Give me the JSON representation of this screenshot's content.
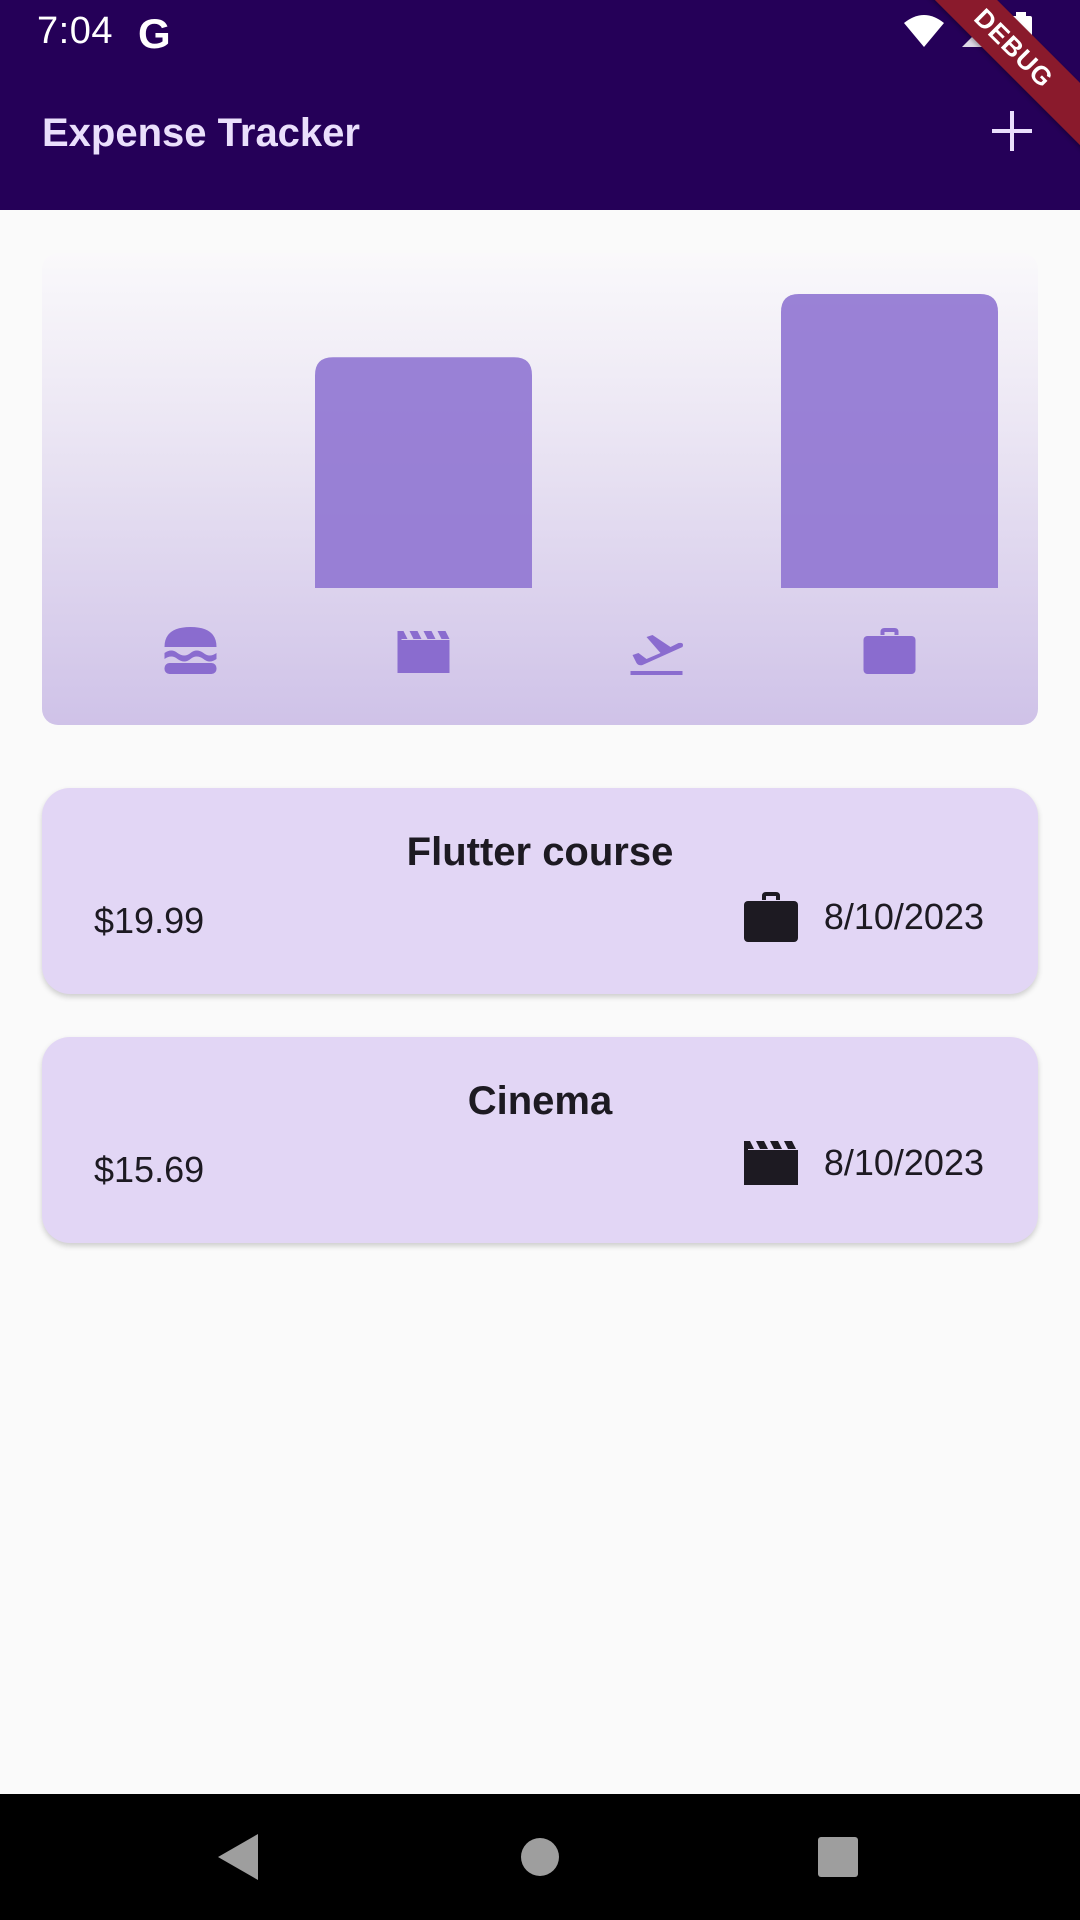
{
  "status_bar": {
    "time": "7:04",
    "g_logo": "G",
    "icons": [
      "wifi-icon",
      "signal-icon",
      "battery-icon"
    ]
  },
  "debug_banner": "DEBUG",
  "app_bar": {
    "title": "Expense Tracker",
    "action_icon": "add-icon"
  },
  "chart_data": {
    "type": "bar",
    "categories": [
      "food",
      "leisure",
      "travel",
      "work"
    ],
    "category_icons": [
      "burger-icon",
      "movie-clapper-icon",
      "flight-takeoff-icon",
      "briefcase-icon"
    ],
    "values": [
      0,
      15.69,
      0,
      19.99
    ],
    "ylim": [
      0,
      19.99
    ],
    "bar_color": "#9177d2",
    "icon_color": "#8a6ccf",
    "grid": false
  },
  "expenses": [
    {
      "title": "Flutter course",
      "amount": "$19.99",
      "category_icon": "briefcase-icon",
      "date": "8/10/2023"
    },
    {
      "title": "Cinema",
      "amount": "$15.69",
      "category_icon": "movie-clapper-icon",
      "date": "8/10/2023"
    }
  ],
  "colors": {
    "app_bar": "#250058",
    "title": "#eadffc",
    "card": "#e2d6f5",
    "text": "#1d1a22"
  },
  "nav_bar": [
    "back-button",
    "home-button",
    "recents-button"
  ]
}
